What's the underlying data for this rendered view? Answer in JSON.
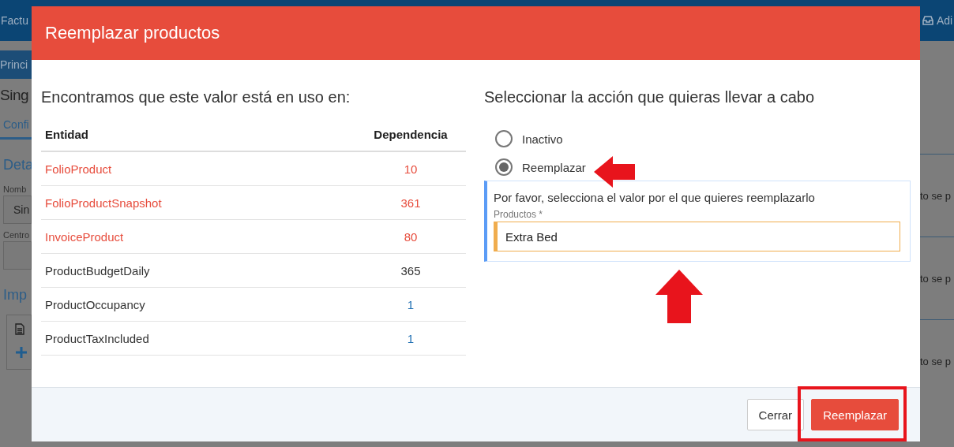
{
  "background": {
    "top_bar": {
      "left_text": "Factu",
      "right_text": "Adi"
    },
    "breadcrumb": "Princi",
    "page_title": "Sing",
    "tab": "Confi",
    "section_1": {
      "title": "Deta",
      "fields": [
        {
          "label": "Nomb",
          "value": "Sin"
        },
        {
          "label": "Centro"
        }
      ]
    },
    "section_2": {
      "title": "Imp"
    },
    "right_rows": [
      "to se p",
      "to se p",
      "to se p"
    ]
  },
  "dialog": {
    "title": "Reemplazar productos",
    "usage": {
      "heading": "Encontramos que este valor está en uso en:",
      "columns": [
        "Entidad",
        "Dependencia"
      ],
      "rows": [
        {
          "entity": {
            "text": "FolioProduct",
            "color": "#e74c3c"
          },
          "dependency": {
            "text": "10",
            "color": "#e74c3c"
          }
        },
        {
          "entity": {
            "text": "FolioProductSnapshot",
            "color": "#e74c3c"
          },
          "dependency": {
            "text": "361",
            "color": "#e74c3c"
          }
        },
        {
          "entity": {
            "text": "InvoiceProduct",
            "color": "#e74c3c"
          },
          "dependency": {
            "text": "80",
            "color": "#e74c3c"
          }
        },
        {
          "entity": {
            "text": "ProductBudgetDaily",
            "color": "#333333"
          },
          "dependency": {
            "text": "365",
            "color": "#333333"
          }
        },
        {
          "entity": {
            "text": "ProductOccupancy",
            "color": "#333333"
          },
          "dependency": {
            "text": "1",
            "color": "#1f6fb2"
          }
        },
        {
          "entity": {
            "text": "ProductTaxIncluded",
            "color": "#333333"
          },
          "dependency": {
            "text": "1",
            "color": "#1f6fb2"
          }
        }
      ]
    },
    "action": {
      "heading": "Seleccionar la acción que quieras llevar a cabo",
      "options": [
        {
          "label": "Inactivo",
          "selected": false
        },
        {
          "label": "Reemplazar",
          "selected": true
        }
      ],
      "replace_box": {
        "text": "Por favor, selecciona el valor por el que quieres reemplazarlo",
        "field_label": "Productos *",
        "value": "Extra Bed"
      }
    },
    "buttons": [
      {
        "label": "Cerrar",
        "kind": "secondary"
      },
      {
        "label": "Reemplazar",
        "kind": "primary"
      }
    ]
  }
}
